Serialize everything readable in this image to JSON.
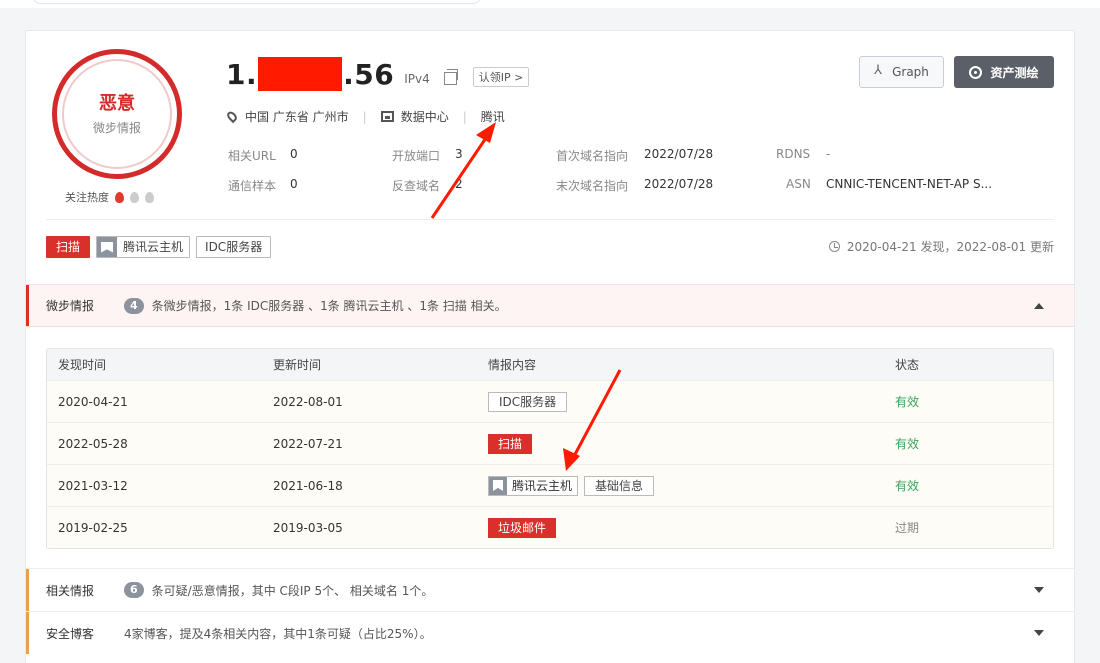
{
  "verdict": {
    "label": "恶意",
    "source": "微步情报",
    "heat_label": "关注热度",
    "heat_level": 1,
    "heat_max": 3
  },
  "ip": {
    "prefix": "1.",
    "suffix": ".56",
    "version": "IPv4",
    "claim_label": "认领IP >"
  },
  "location": "中国 广东省 广州市",
  "datacenter": "数据中心",
  "isp": "腾讯",
  "stats": {
    "related_url_label": "相关URL",
    "related_url": "0",
    "open_ports_label": "开放端口",
    "open_ports": "3",
    "first_domain_label": "首次域名指向",
    "first_domain": "2022/07/28",
    "rdns_label": "RDNS",
    "rdns": "-",
    "comm_samples_label": "通信样本",
    "comm_samples": "0",
    "reverse_domain_label": "反查域名",
    "reverse_domain": "2",
    "last_domain_label": "末次域名指向",
    "last_domain": "2022/07/28",
    "asn_label": "ASN",
    "asn": "CNNIC-TENCENT-NET-AP S..."
  },
  "buttons": {
    "graph": "Graph",
    "asset": "资产测绘"
  },
  "tags": {
    "scan": "扫描",
    "cloud_host": "腾讯云主机",
    "idc": "IDC服务器"
  },
  "discovery": "2020-04-21 发现，2022-08-01 更新",
  "intel_section": {
    "title": "微步情报",
    "count": "4",
    "desc": "条微步情报，1条 IDC服务器 、1条 腾讯云主机 、1条 扫描 相关。",
    "columns": [
      "发现时间",
      "更新时间",
      "情报内容",
      "状态"
    ],
    "rows": [
      {
        "found": "2020-04-21",
        "updated": "2022-08-01",
        "tags": [
          "IDC服务器"
        ],
        "status": "有效"
      },
      {
        "found": "2022-05-28",
        "updated": "2022-07-21",
        "tags": [
          "扫描"
        ],
        "status": "有效"
      },
      {
        "found": "2021-03-12",
        "updated": "2021-06-18",
        "tags": [
          "腾讯云主机",
          "基础信息"
        ],
        "status": "有效"
      },
      {
        "found": "2019-02-25",
        "updated": "2019-03-05",
        "tags": [
          "垃圾邮件"
        ],
        "status": "过期"
      }
    ]
  },
  "related_section": {
    "title": "相关情报",
    "count": "6",
    "desc": "条可疑/恶意情报，其中 C段IP 5个、 相关域名 1个。"
  },
  "blog_section": {
    "title": "安全博客",
    "desc": "4家博客，提及4条相关内容，其中1条可疑（占比25%）。"
  },
  "colors": {
    "malicious": "#d42a2a",
    "valid": "#3aa35a",
    "tag_red": "#d9302c",
    "accent_orange": "#e8a04a"
  }
}
